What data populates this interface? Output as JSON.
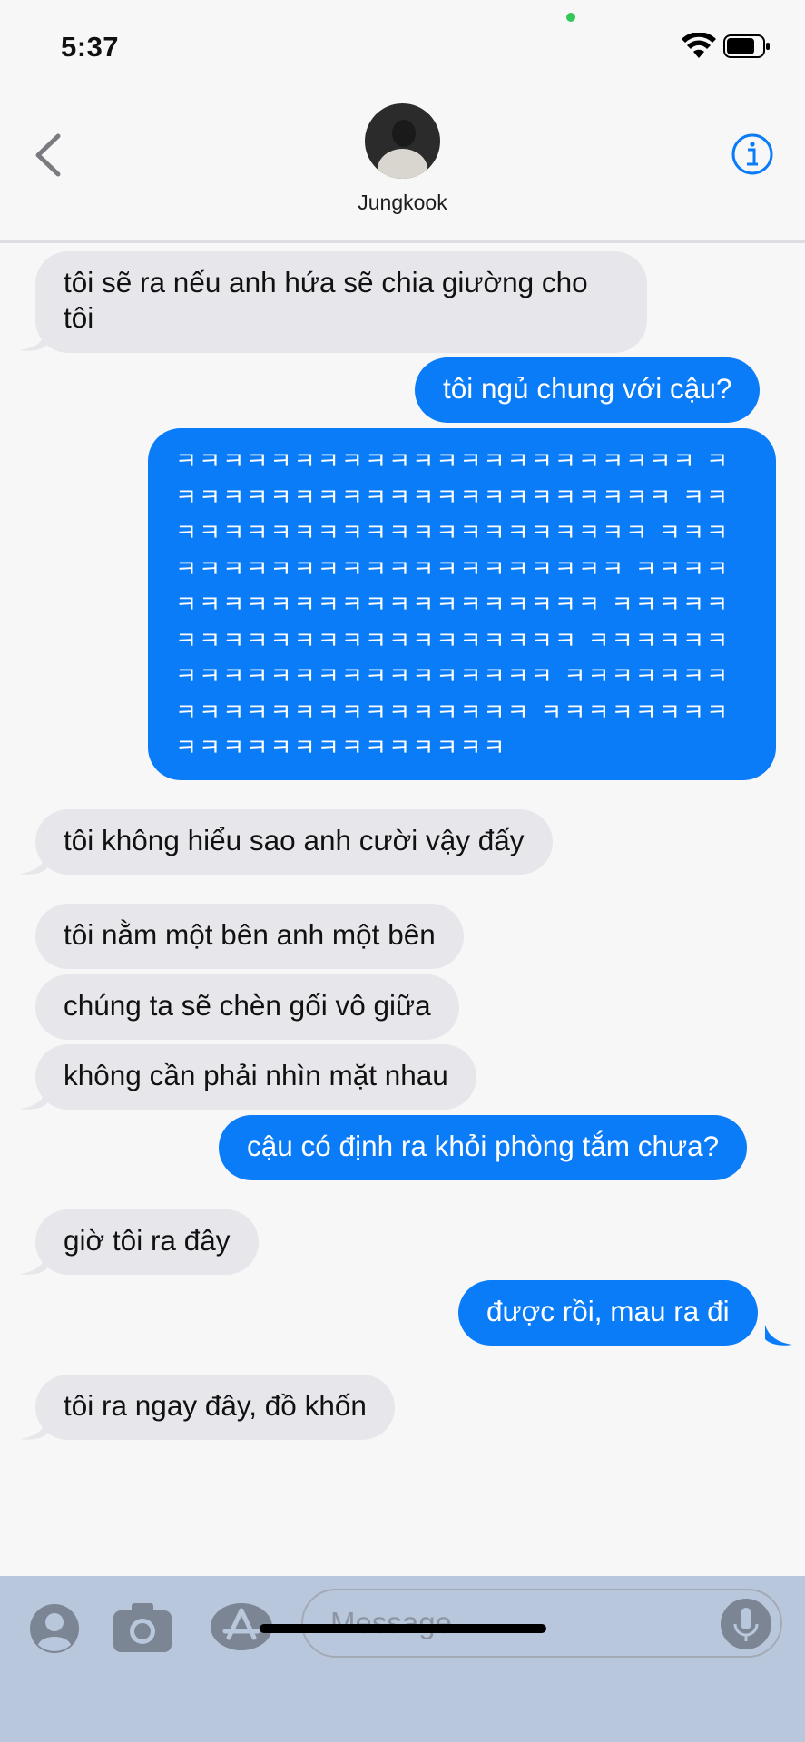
{
  "status_bar": {
    "time": "5:37"
  },
  "header": {
    "contact_name": "Jungkook",
    "back_icon": "chevron-left-icon",
    "info_icon": "info-circle-icon"
  },
  "colors": {
    "sent_bubble": "#0a7cf8",
    "received_bubble": "#e7e6eb",
    "accent": "#0a7cf8",
    "input_bar": "#b9c7dc"
  },
  "messages": [
    {
      "from": "contact",
      "text": "tôi sẽ ra nếu anh hứa sẽ chia giường cho tôi"
    },
    {
      "from": "me",
      "text": "tôi ngủ chung với cậu?"
    },
    {
      "from": "me",
      "text": "ㅋㅋㅋㅋㅋㅋㅋㅋㅋㅋㅋㅋㅋㅋㅋㅋㅋㅋㅋㅋㅋㅋ ㅋㅋㅋㅋㅋㅋㅋㅋㅋㅋㅋㅋㅋㅋㅋㅋㅋㅋㅋㅋㅋㅋ ㅋㅋㅋㅋㅋㅋㅋㅋㅋㅋㅋㅋㅋㅋㅋㅋㅋㅋㅋㅋㅋㅋ ㅋㅋㅋㅋㅋㅋㅋㅋㅋㅋㅋㅋㅋㅋㅋㅋㅋㅋㅋㅋㅋㅋ ㅋㅋㅋㅋㅋㅋㅋㅋㅋㅋㅋㅋㅋㅋㅋㅋㅋㅋㅋㅋㅋㅋ ㅋㅋㅋㅋㅋㅋㅋㅋㅋㅋㅋㅋㅋㅋㅋㅋㅋㅋㅋㅋㅋㅋ ㅋㅋㅋㅋㅋㅋㅋㅋㅋㅋㅋㅋㅋㅋㅋㅋㅋㅋㅋㅋㅋㅋ ㅋㅋㅋㅋㅋㅋㅋㅋㅋㅋㅋㅋㅋㅋㅋㅋㅋㅋㅋㅋㅋㅋ ㅋㅋㅋㅋㅋㅋㅋㅋㅋㅋㅋㅋㅋㅋㅋㅋㅋㅋㅋㅋㅋㅋ"
    },
    {
      "from": "contact",
      "text": "tôi không hiểu sao anh cười vậy đấy"
    },
    {
      "from": "contact",
      "text": "tôi nằm một bên anh một bên"
    },
    {
      "from": "contact",
      "text": "chúng ta sẽ chèn gối vô giữa"
    },
    {
      "from": "contact",
      "text": "không cần phải nhìn mặt nhau"
    },
    {
      "from": "me",
      "text": "cậu có định ra khỏi phòng tắm chưa?"
    },
    {
      "from": "contact",
      "text": "giờ tôi ra đây"
    },
    {
      "from": "me",
      "text": "được rồi, mau ra đi"
    },
    {
      "from": "contact",
      "text": "tôi ra ngay đây, đồ khốn"
    }
  ],
  "input_bar": {
    "placeholder": "Message",
    "left_icons": [
      "contact-avatar-icon",
      "camera-icon",
      "app-store-icon"
    ],
    "mic_icon": "microphone-icon"
  }
}
